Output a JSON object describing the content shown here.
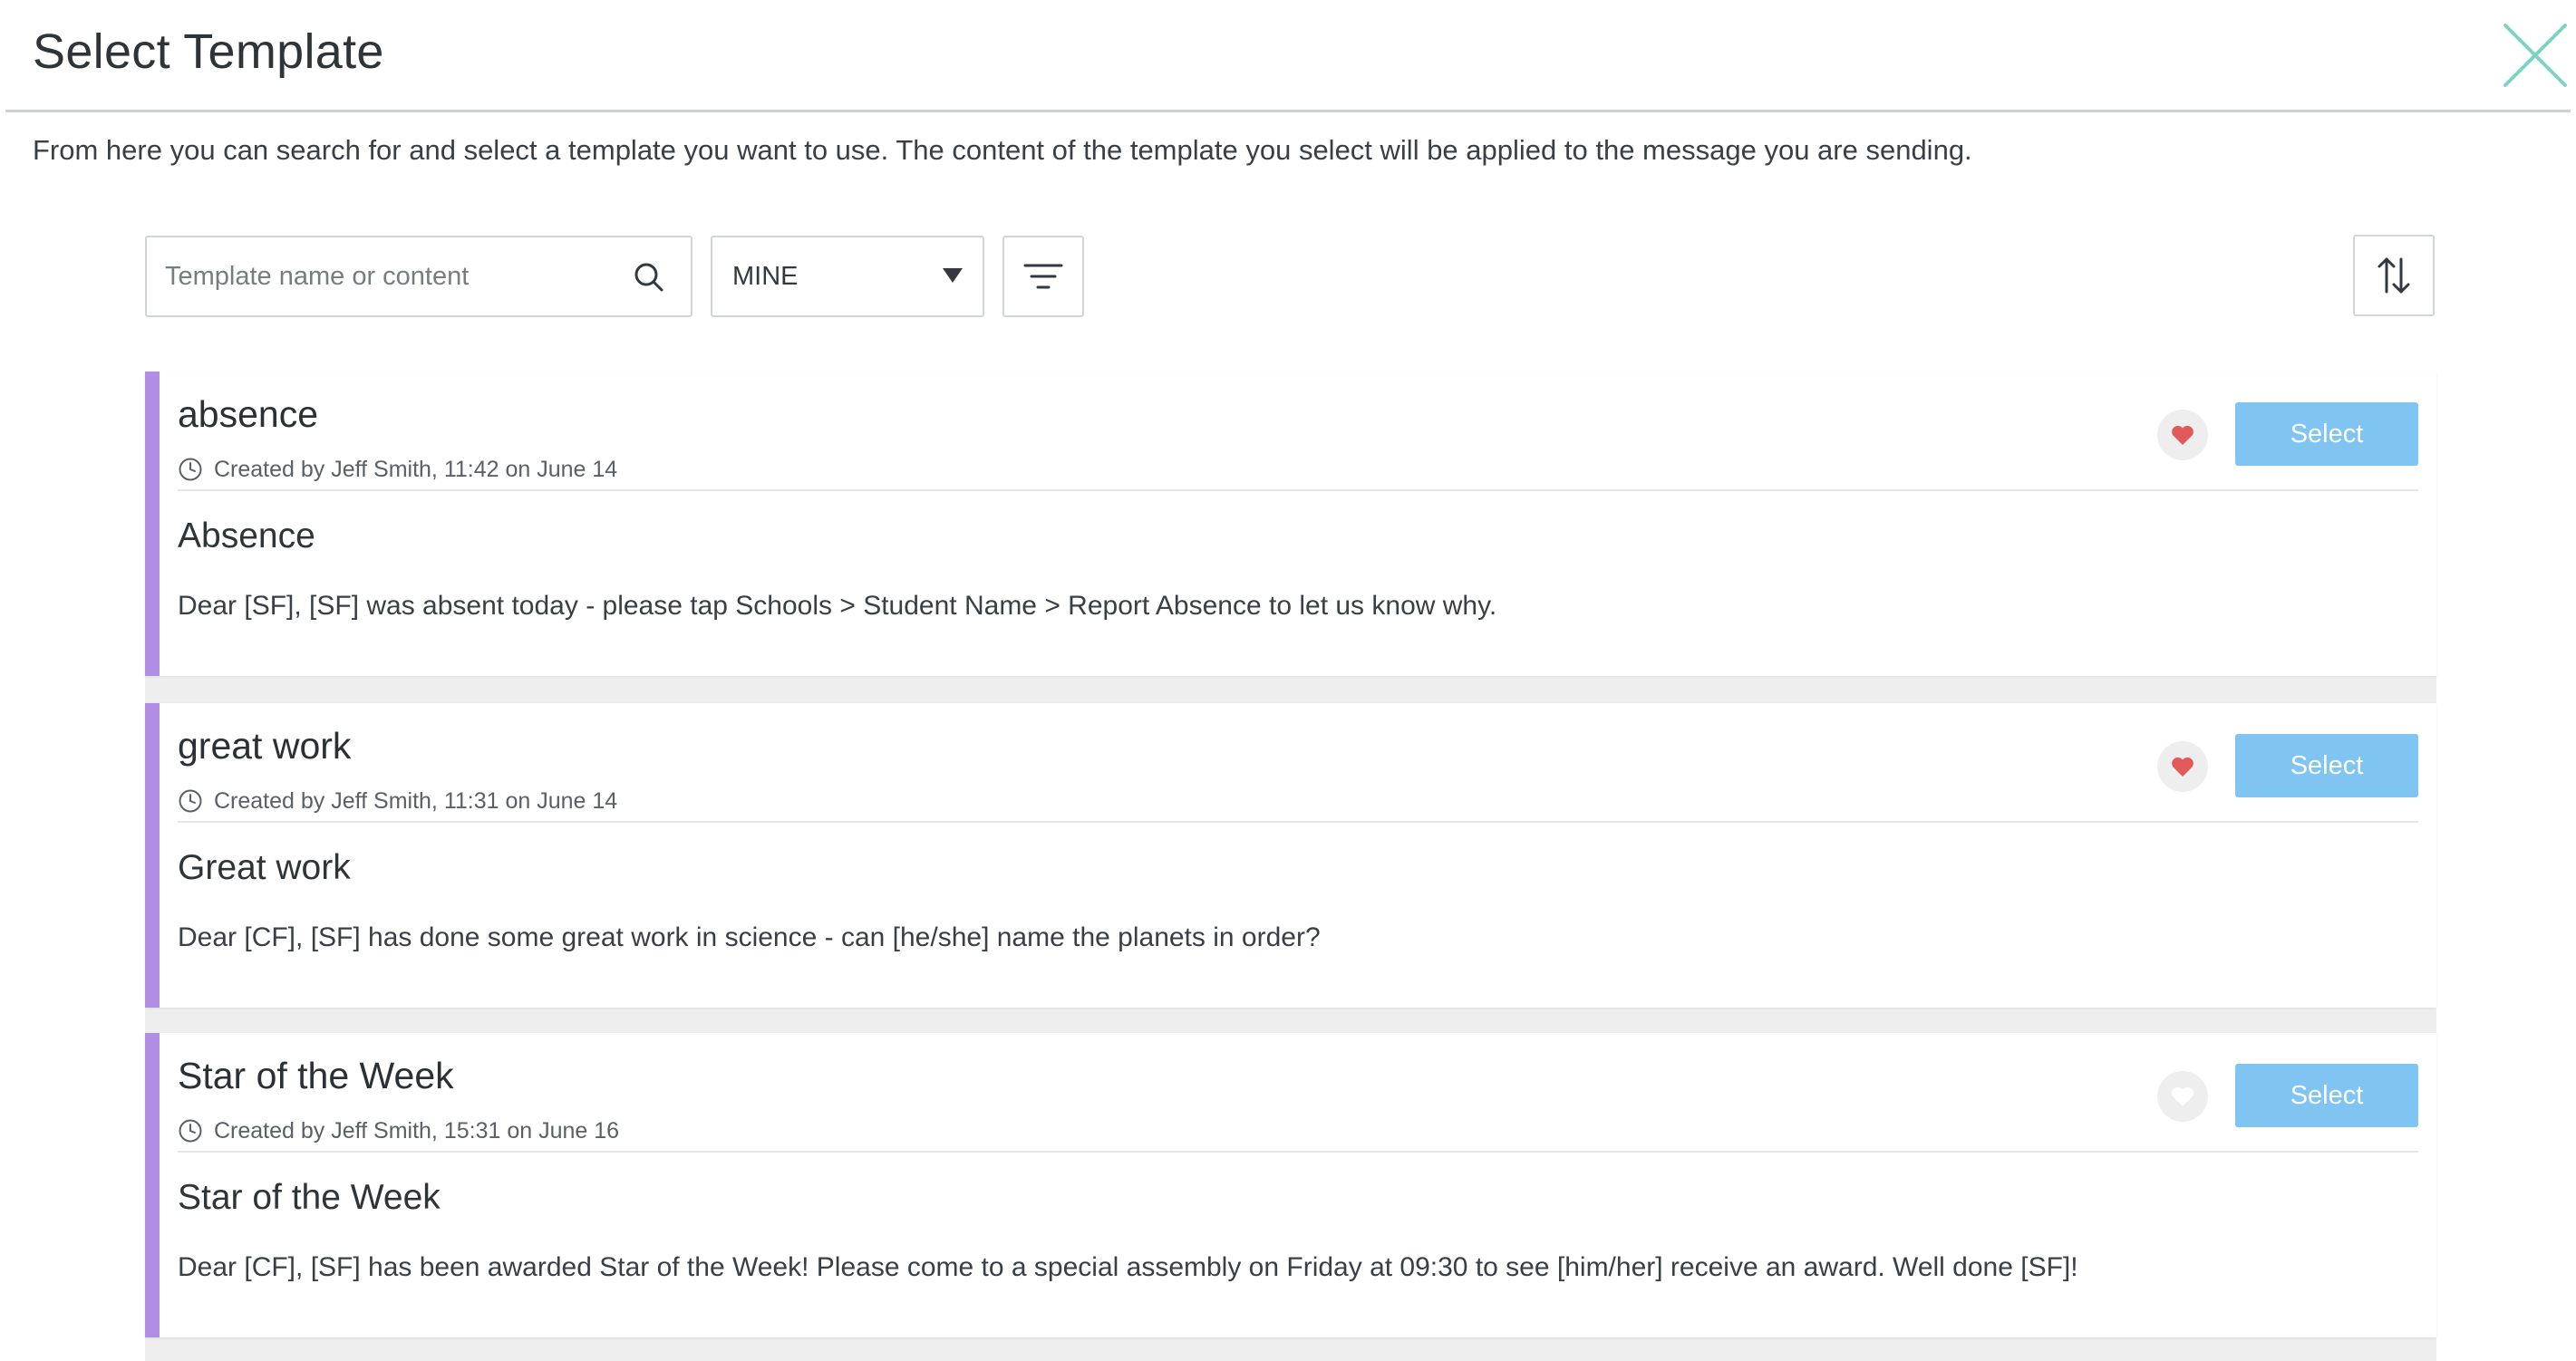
{
  "modal": {
    "title": "Select Template",
    "intro": "From here you can search for and select a template you want to use. The content of the template you select will be applied to the message you are sending."
  },
  "toolbar": {
    "search_placeholder": "Template name or content",
    "search_value": "",
    "filter_value": "MINE",
    "icons": {
      "search": "search-icon",
      "caret": "caret-down-icon",
      "filter": "filter-lines-icon",
      "sort": "sort-arrows-icon"
    }
  },
  "templates": [
    {
      "name": "absence",
      "meta": "Created by Jeff Smith, 11:42 on June 14",
      "favourite": true,
      "select_label": "Select",
      "subject": "Absence",
      "body": "Dear [SF], [SF] was absent today - please tap Schools > Student Name > Report Absence to let us know why."
    },
    {
      "name": "great work",
      "meta": "Created by Jeff Smith, 11:31 on June 14",
      "favourite": true,
      "select_label": "Select",
      "subject": "Great work",
      "body": "Dear [CF], [SF] has done some great work in science - can [he/she] name the planets in order?"
    },
    {
      "name": "Star of the Week",
      "meta": "Created by Jeff Smith, 15:31 on June 16",
      "favourite": false,
      "select_label": "Select",
      "subject": "Star of the Week",
      "body": "Dear [CF], [SF] has been awarded Star of the Week! Please come to a special assembly on Friday at 09:30 to see [him/her] receive an award. Well done [SF]!"
    }
  ],
  "colors": {
    "accent_bar": "#b18ee3",
    "select_button": "#80c4f2",
    "heart_active": "#e05a5a",
    "heart_inactive": "#ffffff",
    "close_icon": "#7fd3c2"
  }
}
